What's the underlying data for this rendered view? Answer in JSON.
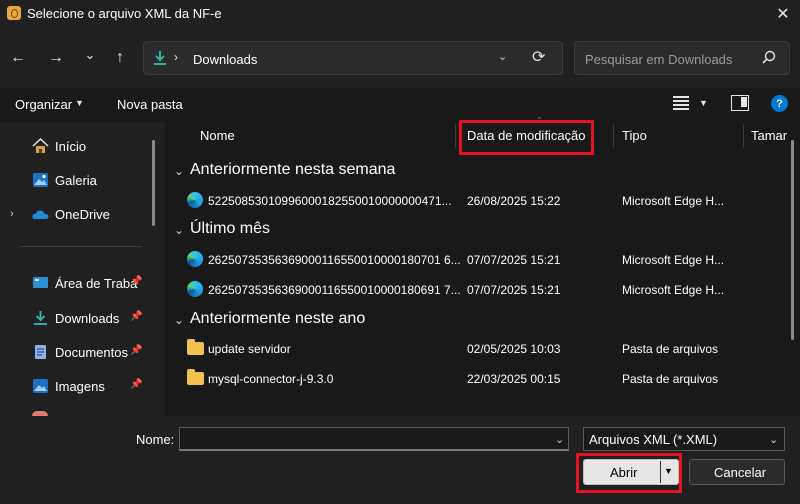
{
  "window": {
    "title": "Selecione o arquivo XML da NF-e",
    "close": "✕"
  },
  "nav": {
    "back": "←",
    "forward": "→",
    "recent": "⌄",
    "up": "↑"
  },
  "address": {
    "chevron": "›",
    "path": "Downloads",
    "dropdown": "⌄",
    "refresh": "⟳"
  },
  "search": {
    "placeholder": "Pesquisar em Downloads"
  },
  "commands": {
    "organize": "Organizar",
    "new_folder": "Nova pasta",
    "help": "?"
  },
  "sidebar": {
    "items": [
      {
        "label": "Início",
        "icon": "home-icon"
      },
      {
        "label": "Galeria",
        "icon": "gallery-icon"
      },
      {
        "label": "OneDrive",
        "icon": "cloud-icon"
      },
      {
        "label": "Área de Traba",
        "icon": "desktop-icon",
        "pinned": true
      },
      {
        "label": "Downloads",
        "icon": "download-icon",
        "pinned": true
      },
      {
        "label": "Documentos",
        "icon": "documents-icon",
        "pinned": true
      },
      {
        "label": "Imagens",
        "icon": "images-icon",
        "pinned": true
      }
    ]
  },
  "columns": {
    "name": "Nome",
    "date": "Data de modificação",
    "type": "Tipo",
    "size": "Tamar"
  },
  "groups": [
    {
      "title": "Anteriormente nesta semana",
      "rows": [
        {
          "name": "52250853010996000182550010000000471...",
          "date": "26/08/2025 15:22",
          "type": "Microsoft Edge H...",
          "icon": "edge-icon"
        }
      ]
    },
    {
      "title": "Último mês",
      "rows": [
        {
          "name": "26250735356369000116550010000180701 6...",
          "date": "07/07/2025 15:21",
          "type": "Microsoft Edge H...",
          "icon": "edge-icon"
        },
        {
          "name": "26250735356369000116550010000180691 7...",
          "date": "07/07/2025 15:21",
          "type": "Microsoft Edge H...",
          "icon": "edge-icon"
        }
      ]
    },
    {
      "title": "Anteriormente neste ano",
      "rows": [
        {
          "name": "update servidor",
          "date": "02/05/2025 10:03",
          "type": "Pasta de arquivos",
          "icon": "folder-icon"
        },
        {
          "name": "mysql-connector-j-9.3.0",
          "date": "22/03/2025 00:15",
          "type": "Pasta de arquivos",
          "icon": "folder-icon"
        }
      ]
    }
  ],
  "footer": {
    "name_label": "Nome:",
    "name_value": "",
    "filetype": "Arquivos XML (*.XML)",
    "open": "Abrir",
    "cancel": "Cancelar"
  },
  "colors": {
    "highlight": "#e3141f",
    "accent": "#0078d4"
  }
}
